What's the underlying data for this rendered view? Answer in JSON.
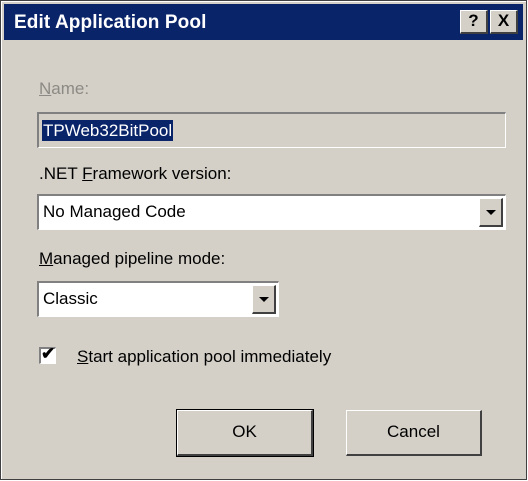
{
  "window": {
    "title": "Edit Application Pool",
    "help_glyph": "?",
    "close_glyph": "X"
  },
  "name": {
    "label_accel": "N",
    "label_rest": "ame:",
    "value": "TPWeb32BitPool"
  },
  "framework": {
    "label_pre": ".NET ",
    "label_accel": "F",
    "label_rest": "ramework version:",
    "selected": "No Managed Code"
  },
  "pipeline": {
    "label_accel": "M",
    "label_rest": "anaged pipeline mode:",
    "selected": "Classic"
  },
  "start_immediately": {
    "checked": true,
    "check_glyph": "✔",
    "label_accel": "S",
    "label_rest": "tart application pool immediately"
  },
  "buttons": {
    "ok": "OK",
    "cancel": "Cancel"
  }
}
